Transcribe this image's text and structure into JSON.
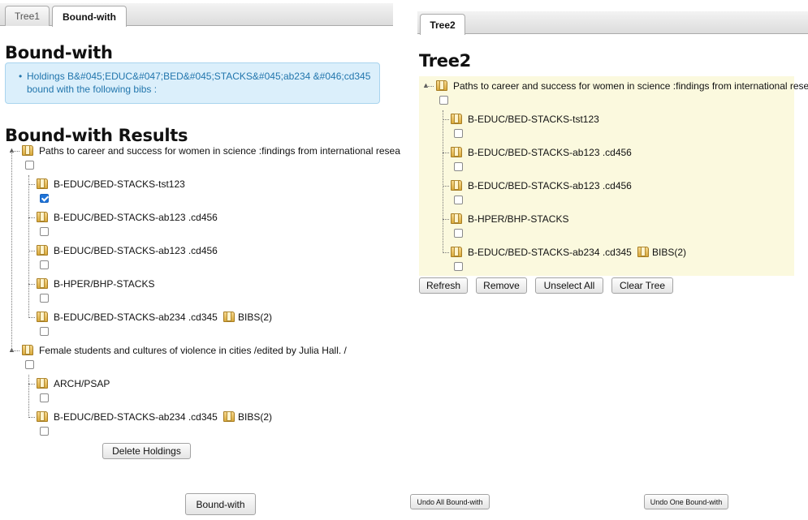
{
  "left_tabs": [
    "Tree1",
    "Bound-with"
  ],
  "left_active_tab": "Bound-with",
  "right_tabs": [
    "Tree2"
  ],
  "bound_with": {
    "heading": "Bound-with",
    "info_bullet": "•",
    "info_text": "Holdings B&#045;EDUC&#047;BED&#045;STACKS&#045;ab234 &#046;cd345 bound with the following bibs :"
  },
  "results": {
    "heading": "Bound-with Results",
    "bibs": [
      {
        "title": "Paths to career and success for women in science :findings from international resea",
        "holdings": [
          {
            "label": "B-EDUC/BED-STACKS-tst123",
            "checked": true
          },
          {
            "label": "B-EDUC/BED-STACKS-ab123 .cd456",
            "checked": false
          },
          {
            "label": "B-EDUC/BED-STACKS-ab123 .cd456",
            "checked": false
          },
          {
            "label": "B-HPER/BHP-STACKS",
            "checked": false
          },
          {
            "label": "B-EDUC/BED-STACKS-ab234 .cd345",
            "checked": false,
            "extra": "BIBS(2)"
          }
        ]
      },
      {
        "title": "Female students and cultures of violence in cities /edited by Julia Hall. /",
        "holdings": [
          {
            "label": "ARCH/PSAP",
            "checked": false
          },
          {
            "label": "B-EDUC/BED-STACKS-ab234 .cd345",
            "checked": false,
            "extra": "BIBS(2)"
          }
        ]
      }
    ],
    "delete_button": "Delete Holdings"
  },
  "tree2": {
    "heading": "Tree2",
    "bib_title": "Paths to career and success for women in science :findings from international resea",
    "holdings": [
      {
        "label": "B-EDUC/BED-STACKS-tst123"
      },
      {
        "label": "B-EDUC/BED-STACKS-ab123 .cd456"
      },
      {
        "label": "B-EDUC/BED-STACKS-ab123 .cd456"
      },
      {
        "label": "B-HPER/BHP-STACKS"
      },
      {
        "label": "B-EDUC/BED-STACKS-ab234 .cd345",
        "extra": "BIBS(2)"
      }
    ],
    "buttons": [
      "Refresh",
      "Remove",
      "Unselect All",
      "Clear Tree"
    ]
  },
  "bottom_buttons": {
    "bound_with": "Bound-with",
    "undo_all": "Undo All Bound-with",
    "undo_one": "Undo One Bound-with"
  },
  "colors": {
    "info_bg": "#dbeffb",
    "info_text": "#2276ad",
    "tree2_bg": "#fbf9de",
    "checkbox_checked": "#1e73d8"
  }
}
